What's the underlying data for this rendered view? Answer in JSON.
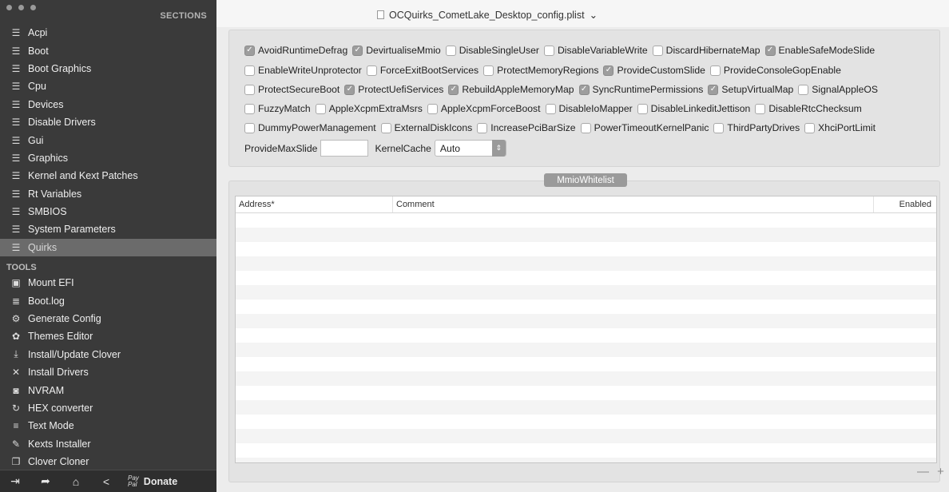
{
  "window": {
    "title": "OCQuirks_CometLake_Desktop_config.plist"
  },
  "sidebar": {
    "sections_title": "SECTIONS",
    "items": [
      {
        "label": "Acpi",
        "icon": "list-icon"
      },
      {
        "label": "Boot",
        "icon": "list-icon"
      },
      {
        "label": "Boot Graphics",
        "icon": "list-icon"
      },
      {
        "label": "Cpu",
        "icon": "list-icon"
      },
      {
        "label": "Devices",
        "icon": "list-icon"
      },
      {
        "label": "Disable Drivers",
        "icon": "list-icon"
      },
      {
        "label": "Gui",
        "icon": "list-icon"
      },
      {
        "label": "Graphics",
        "icon": "list-icon"
      },
      {
        "label": "Kernel and Kext Patches",
        "icon": "list-icon"
      },
      {
        "label": "Rt Variables",
        "icon": "list-icon"
      },
      {
        "label": "SMBIOS",
        "icon": "list-icon"
      },
      {
        "label": "System Parameters",
        "icon": "list-icon"
      },
      {
        "label": "Quirks",
        "icon": "list-icon",
        "selected": true
      }
    ],
    "tools_title": "TOOLS",
    "tools": [
      {
        "label": "Mount EFI",
        "icon": "disk-icon"
      },
      {
        "label": "Boot.log",
        "icon": "log-icon"
      },
      {
        "label": "Generate Config",
        "icon": "gears-icon"
      },
      {
        "label": "Themes Editor",
        "icon": "palette-icon"
      },
      {
        "label": "Install/Update Clover",
        "icon": "download-icon"
      },
      {
        "label": "Install Drivers",
        "icon": "tools-icon"
      },
      {
        "label": "NVRAM",
        "icon": "chip-icon"
      },
      {
        "label": "HEX converter",
        "icon": "refresh-icon"
      },
      {
        "label": "Text Mode",
        "icon": "text-icon"
      },
      {
        "label": "Kexts Installer",
        "icon": "plug-icon"
      },
      {
        "label": "Clover Cloner",
        "icon": "clone-icon"
      }
    ],
    "bottom": {
      "paypal_line1": "Pay",
      "paypal_line2": "Pal",
      "donate_label": "Donate"
    }
  },
  "quirks": {
    "rows": [
      [
        {
          "label": "AvoidRuntimeDefrag",
          "checked": true
        },
        {
          "label": "DevirtualiseMmio",
          "checked": true
        },
        {
          "label": "DisableSingleUser",
          "checked": false
        },
        {
          "label": "DisableVariableWrite",
          "checked": false
        },
        {
          "label": "DiscardHibernateMap",
          "checked": false
        },
        {
          "label": "EnableSafeModeSlide",
          "checked": true
        }
      ],
      [
        {
          "label": "EnableWriteUnprotector",
          "checked": false
        },
        {
          "label": "ForceExitBootServices",
          "checked": false
        },
        {
          "label": "ProtectMemoryRegions",
          "checked": false
        },
        {
          "label": "ProvideCustomSlide",
          "checked": true
        },
        {
          "label": "ProvideConsoleGopEnable",
          "checked": false
        }
      ],
      [
        {
          "label": "ProtectSecureBoot",
          "checked": false
        },
        {
          "label": "ProtectUefiServices",
          "checked": true
        },
        {
          "label": "RebuildAppleMemoryMap",
          "checked": true
        },
        {
          "label": "SyncRuntimePermissions",
          "checked": true
        },
        {
          "label": "SetupVirtualMap",
          "checked": true
        },
        {
          "label": "SignalAppleOS",
          "checked": false
        }
      ],
      [
        {
          "label": "FuzzyMatch",
          "checked": false
        },
        {
          "label": "AppleXcpmExtraMsrs",
          "checked": false
        },
        {
          "label": "AppleXcpmForceBoost",
          "checked": false
        },
        {
          "label": "DisableIoMapper",
          "checked": false
        },
        {
          "label": "DisableLinkeditJettison",
          "checked": false
        },
        {
          "label": "DisableRtcChecksum",
          "checked": false
        }
      ],
      [
        {
          "label": "DummyPowerManagement",
          "checked": false
        },
        {
          "label": "ExternalDiskIcons",
          "checked": false
        },
        {
          "label": "IncreasePciBarSize",
          "checked": false
        },
        {
          "label": "PowerTimeoutKernelPanic",
          "checked": false
        },
        {
          "label": "ThirdPartyDrives",
          "checked": false
        },
        {
          "label": "XhciPortLimit",
          "checked": false
        }
      ]
    ],
    "provide_max_slide_label": "ProvideMaxSlide",
    "provide_max_slide_value": "",
    "kernel_cache_label": "KernelCache",
    "kernel_cache_value": "Auto"
  },
  "mmio": {
    "tab_label": "MmioWhitelist",
    "columns": [
      "Address*",
      "Comment",
      "Enabled"
    ],
    "rows": [],
    "add_remove": "— +"
  }
}
